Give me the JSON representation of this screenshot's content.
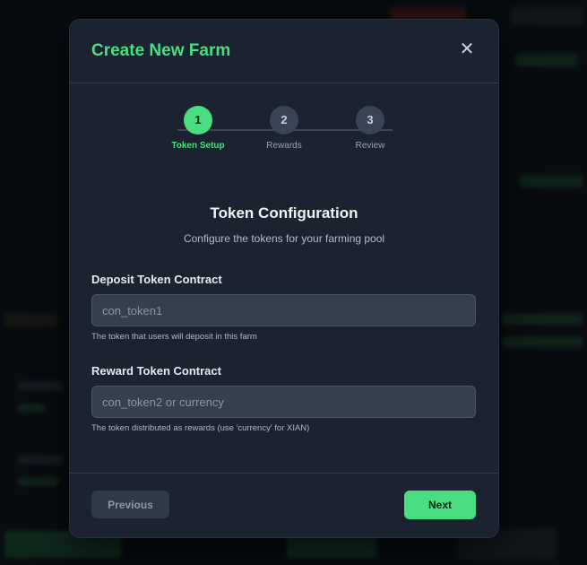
{
  "modal": {
    "title": "Create New Farm",
    "close_glyph": "✕",
    "close_icon": "close-icon"
  },
  "steps": [
    {
      "number": "1",
      "label": "Token Setup",
      "active": true
    },
    {
      "number": "2",
      "label": "Rewards",
      "active": false
    },
    {
      "number": "3",
      "label": "Review",
      "active": false
    }
  ],
  "section": {
    "title": "Token Configuration",
    "subtitle": "Configure the tokens for your farming pool"
  },
  "fields": {
    "deposit": {
      "label": "Deposit Token Contract",
      "placeholder": "con_token1",
      "value": "",
      "help": "The token that users will deposit in this farm"
    },
    "reward": {
      "label": "Reward Token Contract",
      "placeholder": "con_token2 or currency",
      "value": "",
      "help": "The token distributed as rewards (use 'currency' for XIAN)"
    }
  },
  "footer": {
    "previous_label": "Previous",
    "next_label": "Next"
  },
  "colors": {
    "accent": "#4ade80",
    "modal_bg": "#1b2330",
    "page_bg": "#0c1015"
  }
}
